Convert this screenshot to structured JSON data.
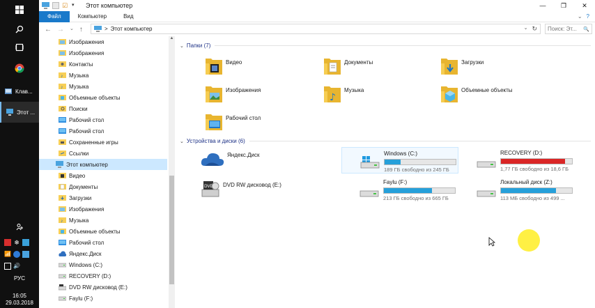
{
  "taskbar": {
    "apps": [
      {
        "label": "Клав...",
        "icon": "keyboard-app-icon"
      },
      {
        "label": "Этот ...",
        "icon": "this-pc-app-icon"
      }
    ],
    "language": "РУС",
    "time": "16:05",
    "date": "29.03.2018"
  },
  "window": {
    "title": "Этот компьютер",
    "tabs": [
      "Файл",
      "Компьютер",
      "Вид"
    ],
    "address": {
      "path": "Этот компьютер",
      "separator": ">"
    },
    "search_placeholder": "Поиск: Эт...",
    "search_suffix": "🔍"
  },
  "navpane": {
    "items": [
      {
        "label": "Изображения",
        "icon": "pictures-icon",
        "indent": 1
      },
      {
        "label": "Изображения",
        "icon": "pictures-icon",
        "indent": 1
      },
      {
        "label": "Контакты",
        "icon": "contacts-icon",
        "indent": 1
      },
      {
        "label": "Музыка",
        "icon": "music-icon",
        "indent": 1
      },
      {
        "label": "Музыка",
        "icon": "music-icon",
        "indent": 1
      },
      {
        "label": "Объемные объекты",
        "icon": "3d-objects-icon",
        "indent": 1
      },
      {
        "label": "Поиски",
        "icon": "searches-icon",
        "indent": 1
      },
      {
        "label": "Рабочий стол",
        "icon": "desktop-icon",
        "indent": 1
      },
      {
        "label": "Рабочий стол",
        "icon": "desktop-icon",
        "indent": 1
      },
      {
        "label": "Сохраненные игры",
        "icon": "saved-games-icon",
        "indent": 1
      },
      {
        "label": "Ссылки",
        "icon": "links-icon",
        "indent": 1
      },
      {
        "label": "Этот компьютер",
        "icon": "this-pc-icon",
        "indent": 0,
        "selected": true
      },
      {
        "label": "Видео",
        "icon": "videos-icon",
        "indent": 1
      },
      {
        "label": "Документы",
        "icon": "documents-icon",
        "indent": 1
      },
      {
        "label": "Загрузки",
        "icon": "downloads-icon",
        "indent": 1
      },
      {
        "label": "Изображения",
        "icon": "pictures-icon",
        "indent": 1
      },
      {
        "label": "Музыка",
        "icon": "music-icon",
        "indent": 1
      },
      {
        "label": "Объемные объекты",
        "icon": "3d-objects-icon",
        "indent": 1
      },
      {
        "label": "Рабочий стол",
        "icon": "desktop-icon",
        "indent": 1
      },
      {
        "label": "Яндекс.Диск",
        "icon": "yandex-disk-icon",
        "indent": 1
      },
      {
        "label": "Windows (C:)",
        "icon": "drive-icon",
        "indent": 1
      },
      {
        "label": "RECOVERY (D:)",
        "icon": "drive-icon",
        "indent": 1
      },
      {
        "label": "DVD RW дисковод (E:)",
        "icon": "dvd-drive-icon",
        "indent": 1
      },
      {
        "label": "Faylu (F:)",
        "icon": "drive-icon",
        "indent": 1
      }
    ]
  },
  "content": {
    "folders_header": "Папки (7)",
    "folders": [
      {
        "label": "Видео",
        "icon": "videos-folder-icon"
      },
      {
        "label": "Документы",
        "icon": "documents-folder-icon"
      },
      {
        "label": "Загрузки",
        "icon": "downloads-folder-icon"
      },
      {
        "label": "Изображения",
        "icon": "pictures-folder-icon"
      },
      {
        "label": "Музыка",
        "icon": "music-folder-icon"
      },
      {
        "label": "Объемные объекты",
        "icon": "3d-objects-folder-icon"
      },
      {
        "label": "Рабочий стол",
        "icon": "desktop-folder-icon"
      }
    ],
    "devices_header": "Устройства и диски (6)",
    "yandex": {
      "label": "Яндекс.Диск",
      "icon": "yandex-disk-cloud-icon"
    },
    "dvd": {
      "label": "DVD RW дисковод (E:)",
      "icon": "dvd-drive-icon"
    },
    "drives": [
      {
        "name": "Windows (C:)",
        "free": "189 ГБ свободно из 245 ГБ",
        "used_fraction": 0.23,
        "color": "#26a0da",
        "icon": "windows-drive-icon",
        "selected": true
      },
      {
        "name": "RECOVERY (D:)",
        "free": "1,77 ГБ свободно из 18,6 ГБ",
        "used_fraction": 0.9,
        "color": "#da2626",
        "icon": "hard-drive-icon"
      },
      {
        "name": "Faylu (F:)",
        "free": "213 ГБ свободно из 665 ГБ",
        "used_fraction": 0.68,
        "color": "#26a0da",
        "icon": "hard-drive-icon"
      },
      {
        "name": "Локальный диск (Z:)",
        "free": "113 МБ свободно из 499 ...",
        "used_fraction": 0.77,
        "color": "#26a0da",
        "icon": "hard-drive-icon"
      }
    ]
  },
  "colors": {
    "accent": "#1979ca",
    "folder": "#f5c94a",
    "selection": "#cce8ff"
  }
}
